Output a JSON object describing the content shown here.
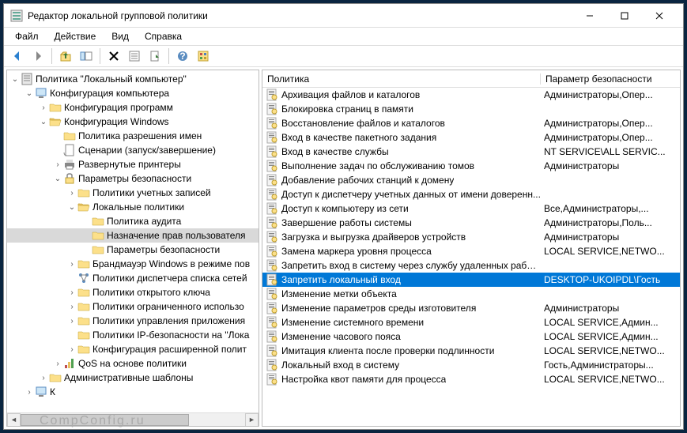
{
  "window": {
    "title": "Редактор локальной групповой политики"
  },
  "menu": {
    "file": "Файл",
    "action": "Действие",
    "view": "Вид",
    "help": "Справка"
  },
  "tree": {
    "root": "Политика \"Локальный компьютер\"",
    "n1": "Конфигурация компьютера",
    "n1_1": "Конфигурация программ",
    "n1_2": "Конфигурация Windows",
    "n1_2_1": "Политика разрешения имен",
    "n1_2_2": "Сценарии (запуск/завершение)",
    "n1_2_3": "Развернутые принтеры",
    "n1_2_4": "Параметры безопасности",
    "n1_2_4_1": "Политики учетных записей",
    "n1_2_4_2": "Локальные политики",
    "n1_2_4_2_1": "Политика аудита",
    "n1_2_4_2_2": "Назначение прав пользователя",
    "n1_2_4_2_3": "Параметры безопасности",
    "n1_2_4_3": "Брандмауэр Windows в режиме пов",
    "n1_2_4_4": "Политики диспетчера списка сетей",
    "n1_2_4_5": "Политики открытого ключа",
    "n1_2_4_6": "Политики ограниченного использо",
    "n1_2_4_7": "Политики управления приложения",
    "n1_2_4_8": "Политики IP-безопасности на \"Лока",
    "n1_2_4_9": "Конфигурация расширенной полит",
    "n1_2_5": "QoS на основе политики",
    "n1_3": "Административные шаблоны",
    "n_trunc": "К"
  },
  "list": {
    "col1": "Политика",
    "col2": "Параметр безопасности",
    "rows": [
      {
        "p": "Архивация файлов и каталогов",
        "v": "Администраторы,Опер..."
      },
      {
        "p": "Блокировка страниц в памяти",
        "v": ""
      },
      {
        "p": "Восстановление файлов и каталогов",
        "v": "Администраторы,Опер..."
      },
      {
        "p": "Вход в качестве пакетного задания",
        "v": "Администраторы,Опер..."
      },
      {
        "p": "Вход в качестве службы",
        "v": "NT SERVICE\\ALL SERVIC..."
      },
      {
        "p": "Выполнение задач по обслуживанию томов",
        "v": "Администраторы"
      },
      {
        "p": "Добавление рабочих станций к домену",
        "v": ""
      },
      {
        "p": "Доступ к диспетчеру учетных данных от имени доверенн...",
        "v": ""
      },
      {
        "p": "Доступ к компьютеру из сети",
        "v": "Все,Администраторы,..."
      },
      {
        "p": "Завершение работы системы",
        "v": "Администраторы,Поль..."
      },
      {
        "p": "Загрузка и выгрузка драйверов устройств",
        "v": "Администраторы"
      },
      {
        "p": "Замена маркера уровня процесса",
        "v": "LOCAL SERVICE,NETWO..."
      },
      {
        "p": "Запретить вход в систему через службу удаленных рабоч...",
        "v": ""
      },
      {
        "p": "Запретить локальный вход",
        "v": "DESKTOP-UKOIPDL\\Гость",
        "sel": true
      },
      {
        "p": "Изменение метки объекта",
        "v": ""
      },
      {
        "p": "Изменение параметров среды изготовителя",
        "v": "Администраторы"
      },
      {
        "p": "Изменение системного времени",
        "v": "LOCAL SERVICE,Админ..."
      },
      {
        "p": "Изменение часового пояса",
        "v": "LOCAL SERVICE,Админ..."
      },
      {
        "p": "Имитация клиента после проверки подлинности",
        "v": "LOCAL SERVICE,NETWO..."
      },
      {
        "p": "Локальный вход в систему",
        "v": "Гость,Администраторы..."
      },
      {
        "p": "Настройка квот памяти для процесса",
        "v": "LOCAL SERVICE,NETWO..."
      }
    ]
  },
  "watermark": "CompConfig.ru"
}
